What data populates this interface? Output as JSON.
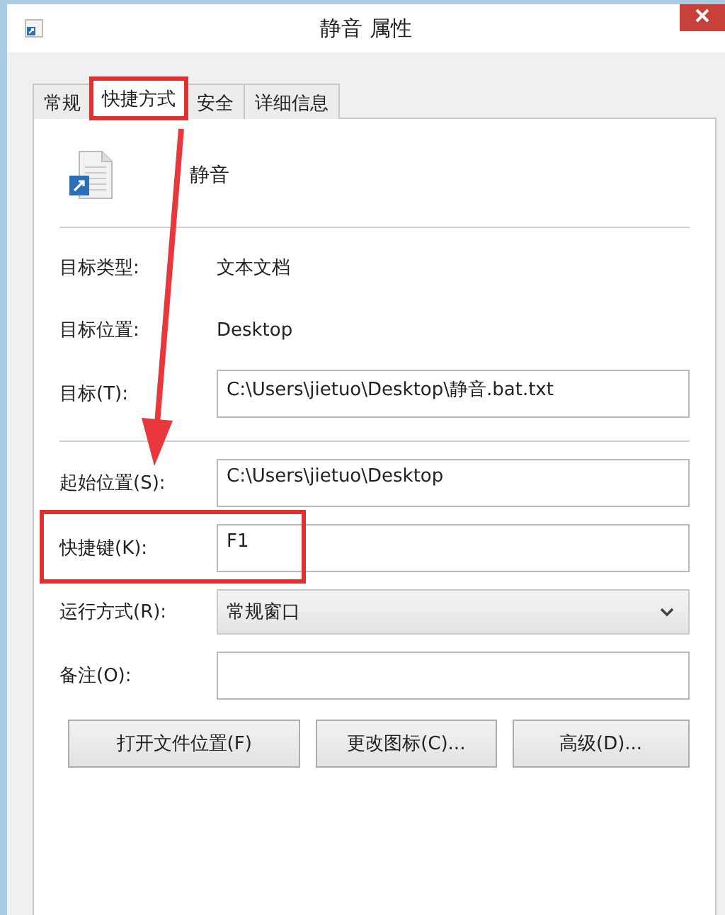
{
  "window": {
    "title": "静音 属性"
  },
  "tabs": [
    {
      "label": "常规",
      "selected": false,
      "highlighted": false
    },
    {
      "label": "快捷方式",
      "selected": true,
      "highlighted": true
    },
    {
      "label": "安全",
      "selected": false,
      "highlighted": false
    },
    {
      "label": "详细信息",
      "selected": false,
      "highlighted": false
    }
  ],
  "file_name": "静音",
  "sections": [
    [
      {
        "kind": "text",
        "label": "目标类型:",
        "value": "文本文档",
        "highlighted": false
      },
      {
        "kind": "text",
        "label": "目标位置:",
        "value": "Desktop",
        "highlighted": false
      },
      {
        "kind": "field",
        "label": "目标(T):",
        "value": "C:\\Users\\jietuo\\Desktop\\静音.bat.txt",
        "highlighted": false
      }
    ],
    [
      {
        "kind": "field",
        "label": "起始位置(S):",
        "value": "C:\\Users\\jietuo\\Desktop",
        "highlighted": false
      },
      {
        "kind": "field",
        "label": "快捷键(K):",
        "value": "F1",
        "highlighted": true
      },
      {
        "kind": "dropdown",
        "label": "运行方式(R):",
        "value": "常规窗口",
        "highlighted": false
      },
      {
        "kind": "field",
        "label": "备注(O):",
        "highlighted": false
      }
    ]
  ],
  "buttons": [
    "打开文件位置(F)",
    "更改图标(C)...",
    "高级(D)..."
  ]
}
